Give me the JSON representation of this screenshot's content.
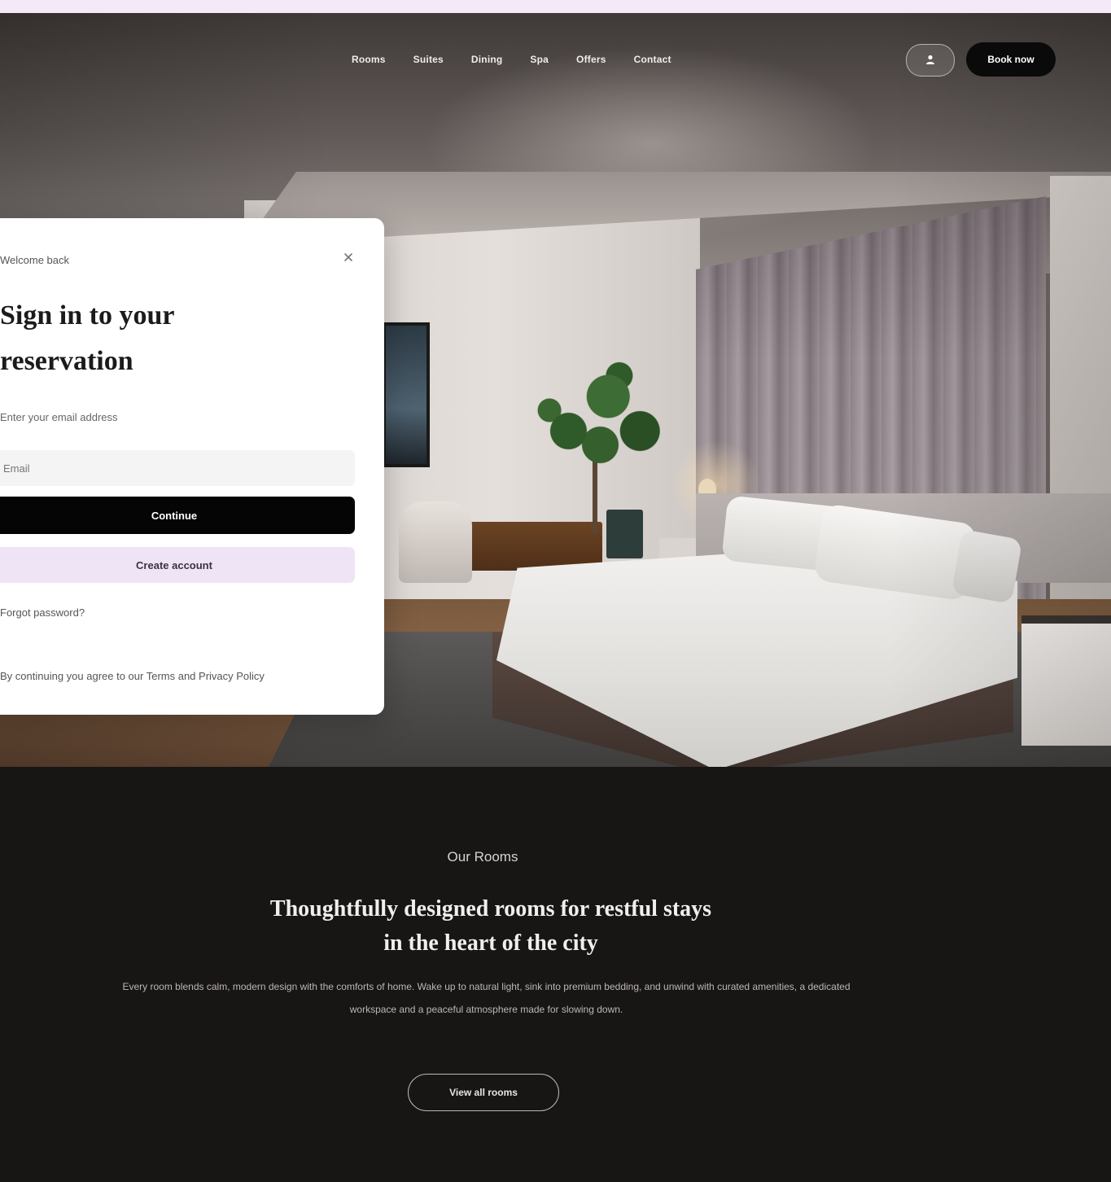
{
  "nav": {
    "links": [
      "Rooms",
      "Suites",
      "Dining",
      "Spa",
      "Offers",
      "Contact"
    ],
    "icon_name": "user-icon",
    "cta_label": "Book now"
  },
  "modal": {
    "eyebrow": "Welcome back",
    "close_icon": "close-icon",
    "title_line1": "Sign in to your",
    "title_line2": "reservation",
    "subtitle": "Enter your email address",
    "input_placeholder": "Email",
    "primary_label": "Continue",
    "secondary_label": "Create account",
    "link_forgot": "Forgot password?",
    "link_terms": "By continuing you agree to our Terms and Privacy Policy"
  },
  "section": {
    "eyebrow": "Our Rooms",
    "title_line1": "Thoughtfully designed rooms for restful stays",
    "title_line2": "in the heart of the city",
    "body": "Every room blends calm, modern design with the comforts of home. Wake up to natural light, sink into premium bedding, and unwind with curated amenities, a dedicated workspace and a peaceful atmosphere made for slowing down.",
    "cta_label": "View all rooms"
  },
  "colors": {
    "accent_lavender": "#efe4f6",
    "dark_bg": "#181615",
    "primary_button": "#050505"
  }
}
